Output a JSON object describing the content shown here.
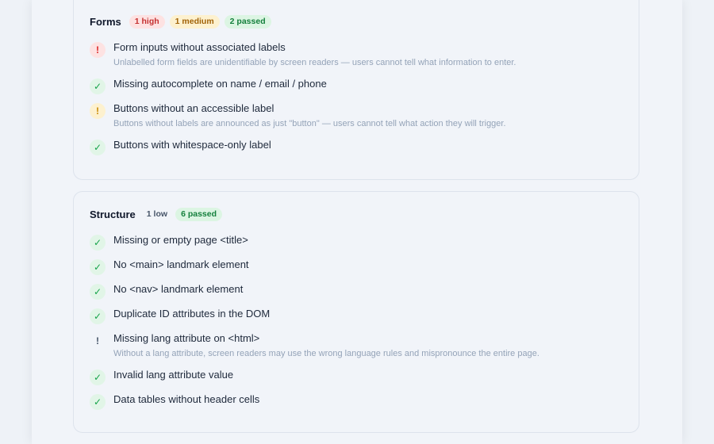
{
  "forms": {
    "title": "Forms",
    "badges": {
      "high": "1 high",
      "medium": "1 medium",
      "passed": "2 passed"
    },
    "items": [
      {
        "status": "high",
        "icon": "!",
        "label": "Form inputs without associated labels",
        "desc": "Unlabelled form fields are unidentifiable by screen readers — users cannot tell what information to enter."
      },
      {
        "status": "pass",
        "icon": "✓",
        "label": "Missing autocomplete on name / email / phone"
      },
      {
        "status": "medium",
        "icon": "!",
        "label": "Buttons without an accessible label",
        "desc": "Buttons without labels are announced as just \"button\" — users cannot tell what action they will trigger."
      },
      {
        "status": "pass",
        "icon": "✓",
        "label": "Buttons with whitespace-only label"
      }
    ]
  },
  "structure": {
    "title": "Structure",
    "badges": {
      "low": "1 low",
      "passed": "6 passed"
    },
    "items": [
      {
        "status": "pass",
        "icon": "✓",
        "label": "Missing or empty page <title>"
      },
      {
        "status": "pass",
        "icon": "✓",
        "label": "No <main> landmark element"
      },
      {
        "status": "pass",
        "icon": "✓",
        "label": "No <nav> landmark element"
      },
      {
        "status": "pass",
        "icon": "✓",
        "label": "Duplicate ID attributes in the DOM"
      },
      {
        "status": "low",
        "icon": "!",
        "label": "Missing lang attribute on <html>",
        "desc": "Without a lang attribute, screen readers may use the wrong language rules and mispronounce the entire page."
      },
      {
        "status": "pass",
        "icon": "✓",
        "label": "Invalid lang attribute value"
      },
      {
        "status": "pass",
        "icon": "✓",
        "label": "Data tables without header cells"
      }
    ]
  },
  "colors": {
    "pass": "#16a34a",
    "high": "#dc2626",
    "medium": "#ca8a04",
    "low": "#475569"
  }
}
